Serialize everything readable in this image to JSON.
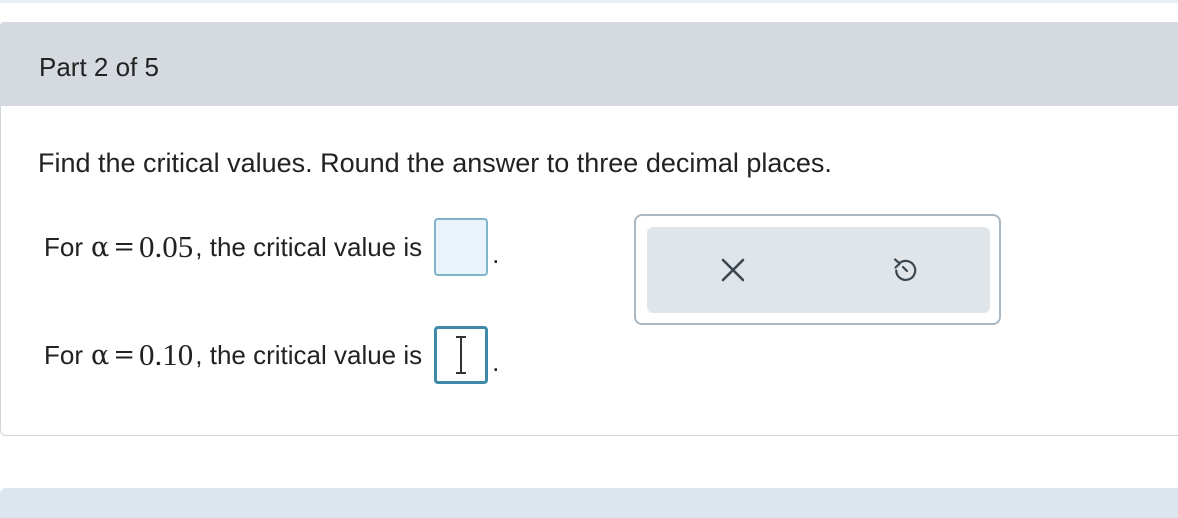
{
  "part": {
    "title": "Part 2 of 5"
  },
  "question": {
    "instructions": "Find the critical values. Round the answer to three decimal places.",
    "rows": [
      {
        "prefix": "For",
        "symbol": "α",
        "equals": "=",
        "value": "0.05",
        "suffix": ", the critical value is",
        "answer": "",
        "terminator": "."
      },
      {
        "prefix": "For",
        "symbol": "α",
        "equals": "=",
        "value": "0.10",
        "suffix": ", the critical value is",
        "answer": "",
        "terminator": "."
      }
    ]
  },
  "toolbox": {
    "clear_icon": "close-icon",
    "undo_icon": "undo-icon"
  },
  "colors": {
    "header_bg": "#d4dadf",
    "input_border": "#7eb3c9",
    "input_active_border": "#3e8aa8",
    "toolbox_bg": "#dfe5e9"
  }
}
